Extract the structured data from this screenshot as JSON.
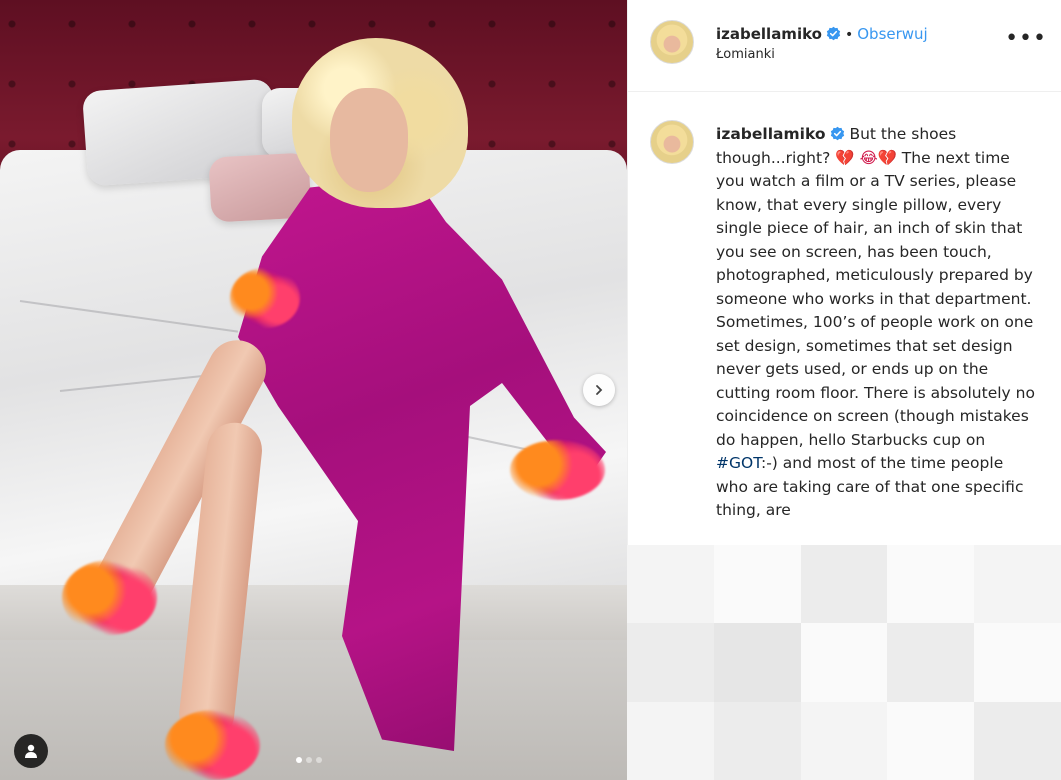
{
  "post": {
    "username": "izabellamiko",
    "separator": "•",
    "follow_label": "Obserwuj",
    "location": "Łomianki",
    "more_label": "•••"
  },
  "caption": {
    "username": "izabellamiko",
    "text_part1": "But the shoes though...right? ",
    "emoji_hearts_1": "💔 😂💔",
    "text_part2": " The next time you watch a film or a TV series, please know, that every single pillow, every single piece of hair, an inch of skin that you see on screen, has been touch, photographed, meticulously prepared by someone who works in that department. Sometimes, 100’s of people work on one set design, sometimes that set design never gets used, or ends up on the cutting room floor. There is absolutely no coincidence on screen (though mistakes do happen, hello Starbucks cup on ",
    "hashtag": "#GOT",
    "text_part3": ":-) and most of the time people who are taking care of that one specific thing, are"
  },
  "carousel": {
    "dot_count": 3,
    "active_index": 0
  },
  "colors": {
    "follow_blue": "#3897f0",
    "verified_blue": "#3897f0",
    "robe_magenta": "#b51386"
  },
  "icons": {
    "verified": "verified-badge-icon",
    "next": "chevron-right-icon",
    "user_tag": "user-tag-icon"
  }
}
